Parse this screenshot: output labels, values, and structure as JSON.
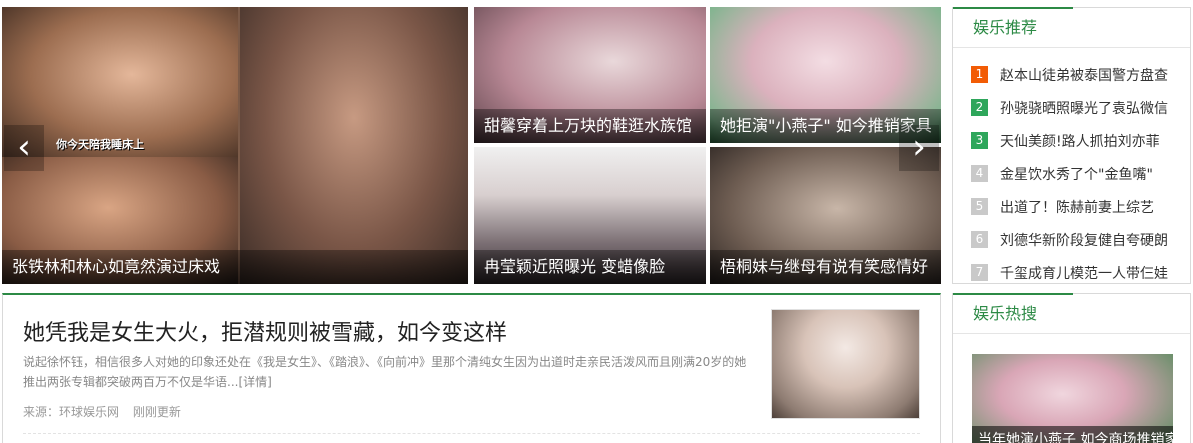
{
  "slider": {
    "main": {
      "caption": "张铁林和林心如竟然演过床戏",
      "subtitle": "你今天陪我睡床上"
    },
    "tiles": [
      {
        "caption": "甜馨穿着上万块的鞋逛水族馆"
      },
      {
        "caption": "她拒演\"小燕子\" 如今推销家具"
      },
      {
        "caption": "冉莹颖近照曝光 变蜡像脸"
      },
      {
        "caption": "梧桐妹与继母有说有笑感情好"
      }
    ],
    "prev_arrow": "‹",
    "next_arrow": "›"
  },
  "recommend": {
    "title": "娱乐推荐",
    "items": [
      {
        "rank": "1",
        "color": "#f25c05",
        "text": "赵本山徒弟被泰国警方盘查"
      },
      {
        "rank": "2",
        "color": "#2ea65b",
        "text": "孙骁骁晒照曝光了袁弘微信"
      },
      {
        "rank": "3",
        "color": "#2ea65b",
        "text": "天仙美颜!路人抓拍刘亦菲"
      },
      {
        "rank": "4",
        "color": "#c9c9c9",
        "text": "金星饮水秀了个\"金鱼嘴\""
      },
      {
        "rank": "5",
        "color": "#c9c9c9",
        "text": "出道了！陈赫前妻上综艺"
      },
      {
        "rank": "6",
        "color": "#c9c9c9",
        "text": "刘德华新阶段复健自夸硬朗"
      },
      {
        "rank": "7",
        "color": "#c9c9c9",
        "text": "千玺成育儿模范一人带仨娃"
      }
    ]
  },
  "hot": {
    "title": "娱乐热搜",
    "caption": "当年她演小燕子 如今商场推销家具"
  },
  "article": {
    "title": "她凭我是女生大火，拒潜规则被雪藏，如今变这样",
    "summary": "说起徐怀钰，相信很多人对她的印象还处在《我是女生》、《踏浪》、《向前冲》里那个清纯女生因为出道时走亲民活泼风而且刚满20岁的她推出两张专辑都突破两百万不仅是华语...",
    "more": "[详情]",
    "source": "来源：环球娱乐网",
    "time": "刚刚更新"
  },
  "colors": {
    "accent": "#2c8a45"
  }
}
